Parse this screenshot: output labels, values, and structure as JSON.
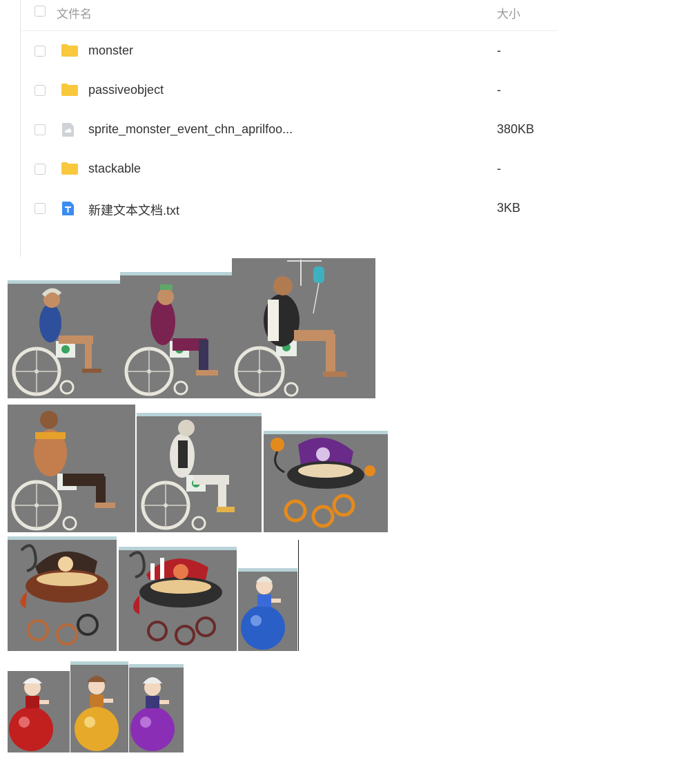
{
  "file_list": {
    "header": {
      "name_label": "文件名",
      "size_label": "大小"
    },
    "files": [
      {
        "name": "monster",
        "size": "-",
        "type": "folder",
        "icon": "folder-icon"
      },
      {
        "name": "passiveobject",
        "size": "-",
        "type": "folder",
        "icon": "folder-icon"
      },
      {
        "name": "sprite_monster_event_chn_aprilfoo...",
        "size": "380KB",
        "type": "file",
        "icon": "generic-file-icon"
      },
      {
        "name": "stackable",
        "size": "-",
        "type": "folder",
        "icon": "folder-icon"
      },
      {
        "name": "新建文本文档.txt",
        "size": "3KB",
        "type": "text",
        "icon": "text-file-icon"
      }
    ]
  },
  "colors": {
    "folder": "#f9c83d",
    "text_icon": "#3b8cf0",
    "generic_icon": "#cfd3d8",
    "sprite_bg": "#7b7b7b",
    "sprite_band": "#b7d3d7",
    "balls": [
      "#2a5fc7",
      "#c21f1f",
      "#e7a92a",
      "#8a2fb5"
    ]
  }
}
